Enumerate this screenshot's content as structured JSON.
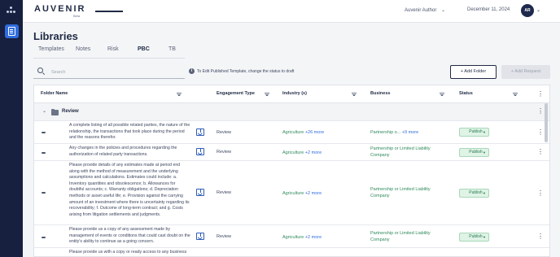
{
  "app": {
    "logo": "AUVENIR",
    "logo_sub": "Beta"
  },
  "header": {
    "user": "Auvenir Author",
    "date": "December 11, 2024",
    "avatar_initials": "AR"
  },
  "page": {
    "title": "Libraries"
  },
  "tabs": [
    {
      "label": "Templates",
      "active": false
    },
    {
      "label": "Notes",
      "active": false
    },
    {
      "label": "Risk",
      "active": false
    },
    {
      "label": "PBC",
      "active": true
    },
    {
      "label": "TB",
      "active": false
    }
  ],
  "search": {
    "placeholder": "Search",
    "value": ""
  },
  "info_text": "To Edit Published Template, change the status to draft",
  "buttons": {
    "add_folder": "+ Add Folder",
    "add_request": "+ Add Request"
  },
  "table": {
    "columns": [
      "Folder Name",
      "Engagement Type",
      "Industry (s)",
      "Business",
      "Status"
    ],
    "group": {
      "name": "Review",
      "expanded": true
    },
    "rows": [
      {
        "description": "A complete listing of all possible related parties, the nature of the relationship, the transactions that took place during the period and the reasons therefor.",
        "engagement_type": "Review",
        "industry": "Agriculture",
        "industry_more": "+26 more",
        "business": "Partnership o...",
        "business_more": "+9 more",
        "status": "Publish"
      },
      {
        "description": "Any changes in the policies and procedures regarding the authorization of related party transactions.",
        "engagement_type": "Review",
        "industry": "Agriculture",
        "industry_more": "+2 more",
        "business": "Partnership or Limited Liability Company",
        "business_more": "",
        "status": "Publish"
      },
      {
        "description": "Please provide details of any estimates made at period end along with the method of measurement and the underlying assumptions and calculations. Estimates could include: a. Inventory quantities and obsolescence; b. Allowances for doubtful accounts; c. Warranty obligations; d. Depreciation methods or asset useful life; e. Provision against the carrying amount of an investment where there is uncertainty regarding its recoverability; f. Outcome of long-term contract; and g. Costs arising from litigation settlements and judgments.",
        "engagement_type": "Review",
        "industry": "Agriculture",
        "industry_more": "+2 more",
        "business": "Partnership or Limited Liability Company",
        "business_more": "",
        "status": "Publish"
      },
      {
        "description": "Please provide us a copy of any assessment made by management of events or conditions that could cast doubt on the entity's ability to continue as a going concern.",
        "engagement_type": "Review",
        "industry": "Agriculture",
        "industry_more": "+2 more",
        "business": "Partnership or Limited Liability Company",
        "business_more": "",
        "status": "Publish"
      },
      {
        "description": "Please provide us with a copy or ready access to any business",
        "engagement_type": "",
        "industry": "",
        "industry_more": "",
        "business": "",
        "business_more": "",
        "status": ""
      }
    ]
  }
}
